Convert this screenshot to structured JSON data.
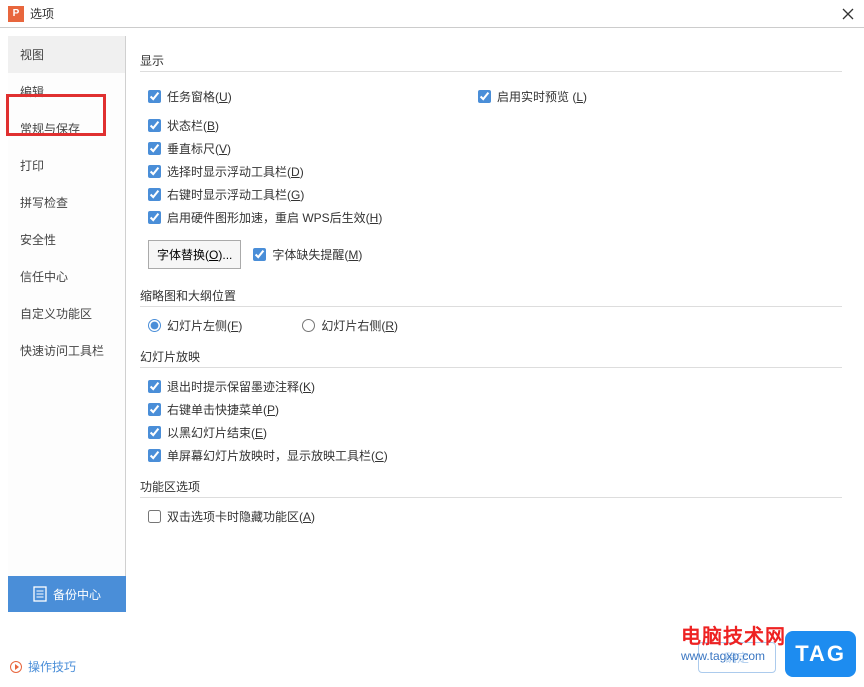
{
  "titlebar": {
    "title": "选项"
  },
  "sidebar": {
    "items": [
      "视图",
      "编辑",
      "常规与保存",
      "打印",
      "拼写检查",
      "安全性",
      "信任中心",
      "自定义功能区",
      "快速访问工具栏"
    ]
  },
  "backup": {
    "label": "备份中心"
  },
  "footer": {
    "label": "操作技巧"
  },
  "ok": {
    "label": "确定"
  },
  "content": {
    "display": {
      "title": "显示",
      "taskpane": "任务窗格",
      "taskpane_key": "U",
      "preview": "启用实时预览 ",
      "preview_key": "L",
      "statusbar": "状态栏",
      "statusbar_key": "B",
      "ruler": "垂直标尺",
      "ruler_key": "V",
      "floating_select": "选择时显示浮动工具栏",
      "floating_select_key": "D",
      "floating_right": "右键时显示浮动工具栏",
      "floating_right_key": "G",
      "hwaccel": "启用硬件图形加速，重启 WPS后生效",
      "hwaccel_key": "H",
      "font_replace_btn": "字体替换",
      "font_replace_key": "O",
      "font_missing": "字体缺失提醒",
      "font_missing_key": "M"
    },
    "thumb": {
      "title": "缩略图和大纲位置",
      "left_label": "幻灯片左侧",
      "left_key": "F",
      "right_label": "幻灯片右侧",
      "right_key": "R"
    },
    "slideshow": {
      "title": "幻灯片放映",
      "ink": "退出时提示保留墨迹注释",
      "ink_key": "K",
      "menu": "右键单击快捷菜单",
      "menu_key": "P",
      "blackend": "以黑幻灯片结束",
      "blackend_key": "E",
      "single": "单屏幕幻灯片放映时，显示放映工具栏",
      "single_key": "C"
    },
    "ribbon": {
      "title": "功能区选项",
      "dbltab": "双击选项卡时隐藏功能区",
      "dbltab_key": "A"
    }
  },
  "watermark": {
    "line1": "电脑技术网",
    "line2": "www.tagxp.com"
  },
  "tag": {
    "label": "TAG"
  }
}
